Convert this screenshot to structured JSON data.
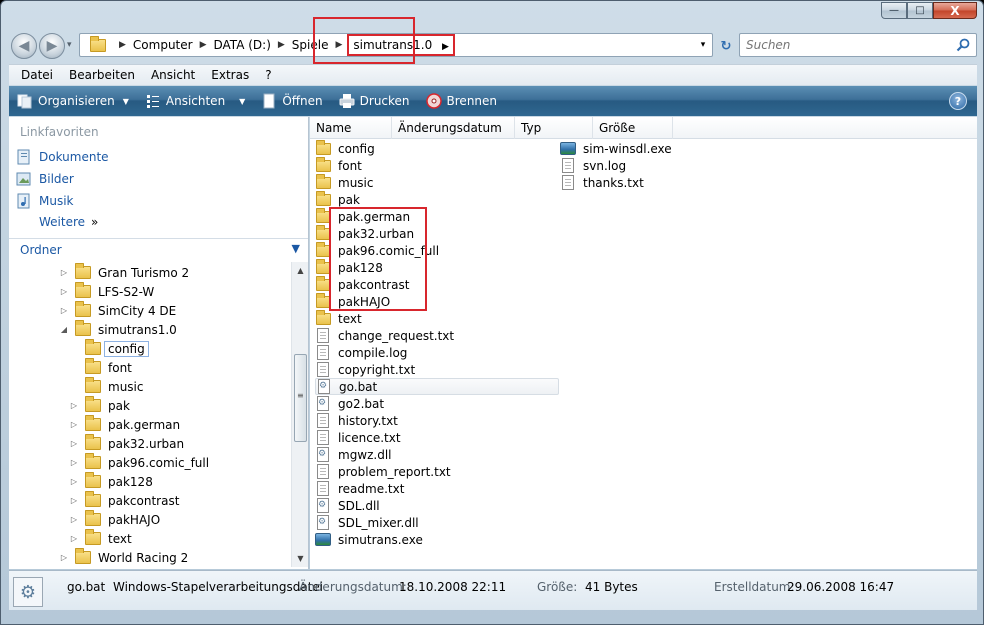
{
  "window": {
    "close_glyph": "X",
    "min_glyph": "—",
    "max_glyph": "□"
  },
  "addressbar": {
    "crumbs": [
      "Computer",
      "DATA (D:)",
      "Spiele",
      "simutrans1.0"
    ]
  },
  "search": {
    "placeholder": "Suchen"
  },
  "menu": [
    "Datei",
    "Bearbeiten",
    "Ansicht",
    "Extras",
    "?"
  ],
  "commands": {
    "organize": "Organisieren",
    "views": "Ansichten",
    "open": "Öffnen",
    "print": "Drucken",
    "burn": "Brennen",
    "help": "?"
  },
  "navpane": {
    "favorites_title": "Linkfavoriten",
    "favorites": [
      "Dokumente",
      "Bilder",
      "Musik"
    ],
    "more": "Weitere",
    "more_glyph": "»",
    "folders_title": "Ordner",
    "tree": [
      {
        "label": "Gran Turismo 2",
        "level": 0,
        "twisty": "▷"
      },
      {
        "label": "LFS-S2-W",
        "level": 0,
        "twisty": "▷"
      },
      {
        "label": "SimCity 4 DE",
        "level": 0,
        "twisty": "▷"
      },
      {
        "label": "simutrans1.0",
        "level": 0,
        "twisty": "◢"
      },
      {
        "label": "config",
        "level": 1,
        "twisty": "",
        "selected": true
      },
      {
        "label": "font",
        "level": 1,
        "twisty": ""
      },
      {
        "label": "music",
        "level": 1,
        "twisty": ""
      },
      {
        "label": "pak",
        "level": 1,
        "twisty": "▷"
      },
      {
        "label": "pak.german",
        "level": 1,
        "twisty": "▷"
      },
      {
        "label": "pak32.urban",
        "level": 1,
        "twisty": "▷"
      },
      {
        "label": "pak96.comic_full",
        "level": 1,
        "twisty": "▷"
      },
      {
        "label": "pak128",
        "level": 1,
        "twisty": "▷"
      },
      {
        "label": "pakcontrast",
        "level": 1,
        "twisty": "▷"
      },
      {
        "label": "pakHAJO",
        "level": 1,
        "twisty": "▷"
      },
      {
        "label": "text",
        "level": 1,
        "twisty": "▷"
      },
      {
        "label": "World Racing 2",
        "level": 0,
        "twisty": "▷"
      }
    ]
  },
  "columns": [
    "Name",
    "Änderungsdatum",
    "Typ",
    "Größe"
  ],
  "files_col1": [
    {
      "name": "config",
      "type": "folder"
    },
    {
      "name": "font",
      "type": "folder"
    },
    {
      "name": "music",
      "type": "folder"
    },
    {
      "name": "pak",
      "type": "folder"
    },
    {
      "name": "pak.german",
      "type": "folder"
    },
    {
      "name": "pak32.urban",
      "type": "folder"
    },
    {
      "name": "pak96.comic_full",
      "type": "folder"
    },
    {
      "name": "pak128",
      "type": "folder"
    },
    {
      "name": "pakcontrast",
      "type": "folder"
    },
    {
      "name": "pakHAJO",
      "type": "folder"
    },
    {
      "name": "text",
      "type": "folder"
    },
    {
      "name": "change_request.txt",
      "type": "doc"
    },
    {
      "name": "compile.log",
      "type": "doc"
    },
    {
      "name": "copyright.txt",
      "type": "doc"
    },
    {
      "name": "go.bat",
      "type": "bat",
      "hover": true
    },
    {
      "name": "go2.bat",
      "type": "bat"
    },
    {
      "name": "history.txt",
      "type": "doc"
    },
    {
      "name": "licence.txt",
      "type": "doc"
    },
    {
      "name": "mgwz.dll",
      "type": "dll"
    },
    {
      "name": "problem_report.txt",
      "type": "doc"
    },
    {
      "name": "readme.txt",
      "type": "doc"
    },
    {
      "name": "SDL.dll",
      "type": "dll"
    },
    {
      "name": "SDL_mixer.dll",
      "type": "dll"
    },
    {
      "name": "simutrans.exe",
      "type": "exe"
    }
  ],
  "files_col2": [
    {
      "name": "sim-winsdl.exe",
      "type": "exe"
    },
    {
      "name": "svn.log",
      "type": "doc"
    },
    {
      "name": "thanks.txt",
      "type": "doc"
    }
  ],
  "details": {
    "name": "go.bat",
    "filetype": "Windows-Stapelverarbeitungsdatei",
    "modified_label": "Änderungsdatum:",
    "modified_value": "18.10.2008 22:11",
    "size_label": "Größe:",
    "size_value": "41 Bytes",
    "created_label": "Erstelldatum:",
    "created_value": "29.06.2008 16:47"
  },
  "colors": {
    "highlight_box": "#d8262d",
    "command_bar": "#2f6790",
    "link": "#1b58a4"
  },
  "icons": {
    "back": "◀",
    "forward": "▶",
    "dropdown": "▾",
    "refresh": "↻",
    "expand": "▼",
    "sep": "▶",
    "tree_scroll_up": "▲",
    "tree_scroll_down": "▼",
    "grip": "≡",
    "gear": "⚙"
  }
}
